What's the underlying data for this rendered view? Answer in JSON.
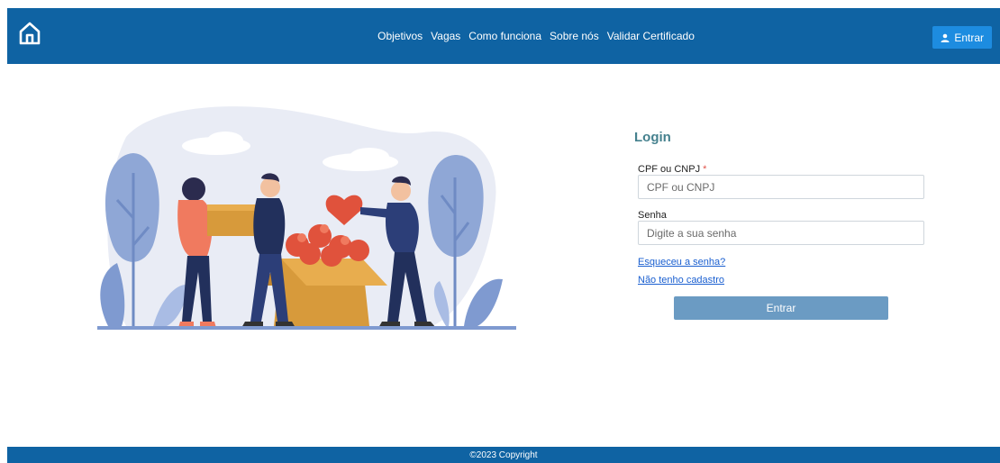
{
  "nav": {
    "links": [
      {
        "label": "Objetivos"
      },
      {
        "label": "Vagas"
      },
      {
        "label": "Como funciona"
      },
      {
        "label": "Sobre nós"
      },
      {
        "label": "Validar Certificado"
      }
    ],
    "login_label": "Entrar",
    "home_icon": "home-icon",
    "user_icon": "user-icon"
  },
  "form": {
    "title": "Login",
    "cpf": {
      "label": "CPF ou CNPJ",
      "required_mark": "*",
      "placeholder": "CPF ou CNPJ",
      "value": ""
    },
    "password": {
      "label": "Senha",
      "placeholder": "Digite a sua senha",
      "value": ""
    },
    "forgot_link": "Esqueceu a senha?",
    "register_link": "Não tenho cadastro",
    "submit_label": "Entrar"
  },
  "footer": {
    "copyright": "©2023 Copyright"
  },
  "colors": {
    "brand": "#0f63a3",
    "accent_button": "#1d8ce0",
    "submit": "#6b9bc3",
    "title": "#45818e"
  }
}
